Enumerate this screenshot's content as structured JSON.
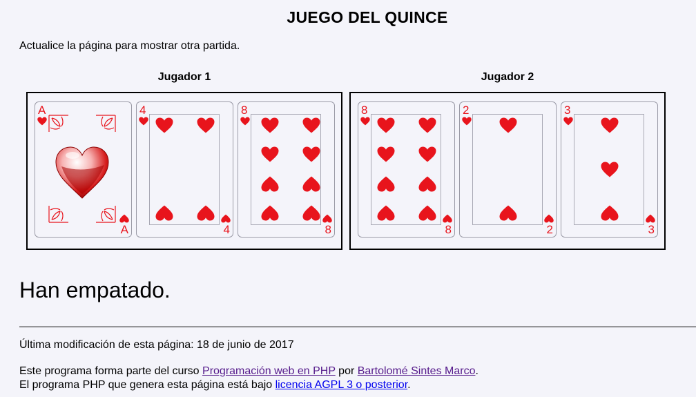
{
  "page": {
    "title": "JUEGO DEL QUINCE",
    "instruction": "Actualice la página para mostrar otra partida."
  },
  "players": [
    {
      "name": "Jugador 1",
      "cards": [
        {
          "rank": "A",
          "suit": "hearts",
          "color": "#e8141c"
        },
        {
          "rank": "4",
          "suit": "hearts",
          "color": "#e8141c"
        },
        {
          "rank": "8",
          "suit": "hearts",
          "color": "#e8141c"
        }
      ]
    },
    {
      "name": "Jugador 2",
      "cards": [
        {
          "rank": "8",
          "suit": "hearts",
          "color": "#e8141c"
        },
        {
          "rank": "2",
          "suit": "hearts",
          "color": "#e8141c"
        },
        {
          "rank": "3",
          "suit": "hearts",
          "color": "#e8141c"
        }
      ]
    }
  ],
  "result": "Han empatado.",
  "footer": {
    "modified": "Última modificación de esta página: 18 de junio de 2017",
    "line1_prefix": "Este programa forma parte del curso ",
    "course_link": "Programación web en PHP",
    "line1_mid": " por ",
    "author_link": "Bartolomé Sintes Marco",
    "line1_suffix": ".",
    "line2_prefix": "El programa PHP que genera esta página está bajo ",
    "license_link": "licencia AGPL 3 o posterior",
    "line2_suffix": "."
  }
}
